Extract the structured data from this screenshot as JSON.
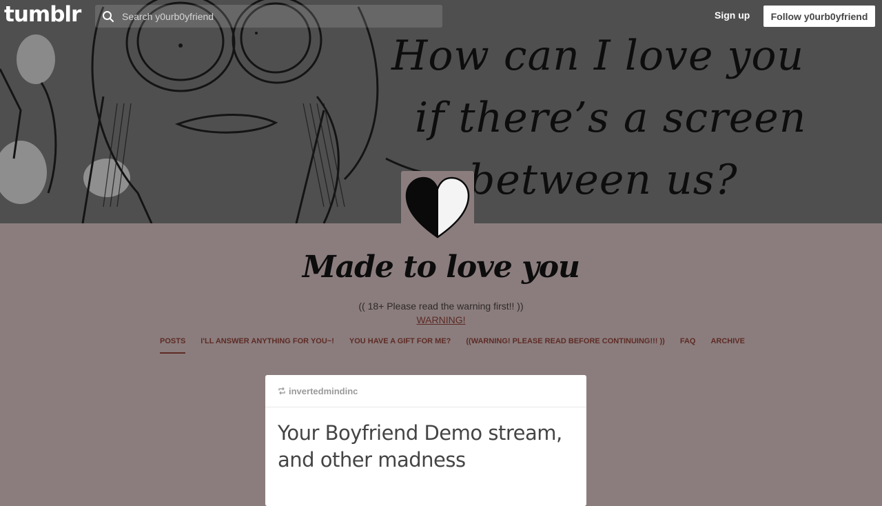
{
  "topbar": {
    "logo": "tumblr",
    "search_placeholder": "Search y0urb0yfriend",
    "signup_label": "Sign up",
    "follow_label": "Follow y0urb0yfriend"
  },
  "header": {
    "banner_lines": [
      "How can I love you",
      "if there’s a screen",
      "between us?"
    ]
  },
  "blog": {
    "title": "Made to love you",
    "description": "(( 18+ Please read the warning first!! ))",
    "warning_link": "WARNING!"
  },
  "nav": {
    "tabs": [
      {
        "label": "POSTS",
        "active": true
      },
      {
        "label": "I'LL ANSWER ANYTHING FOR YOU~!",
        "active": false
      },
      {
        "label": "YOU HAVE A GIFT FOR ME?",
        "active": false
      },
      {
        "label": "((WARNING! PLEASE READ BEFORE CONTINUING!!! ))",
        "active": false
      },
      {
        "label": "FAQ",
        "active": false
      },
      {
        "label": "ARCHIVE",
        "active": false
      }
    ]
  },
  "post": {
    "reblogged_from": "invertedmindinc",
    "title": "Your Boyfriend Demo stream, and other madness"
  },
  "colors": {
    "page_background": "#8b7d7e",
    "banner_background": "#4e4e4e",
    "link_color": "#5e2b24"
  },
  "icons": {
    "search": "search-icon",
    "reblog": "reblog-icon",
    "avatar": "heart-icon"
  }
}
